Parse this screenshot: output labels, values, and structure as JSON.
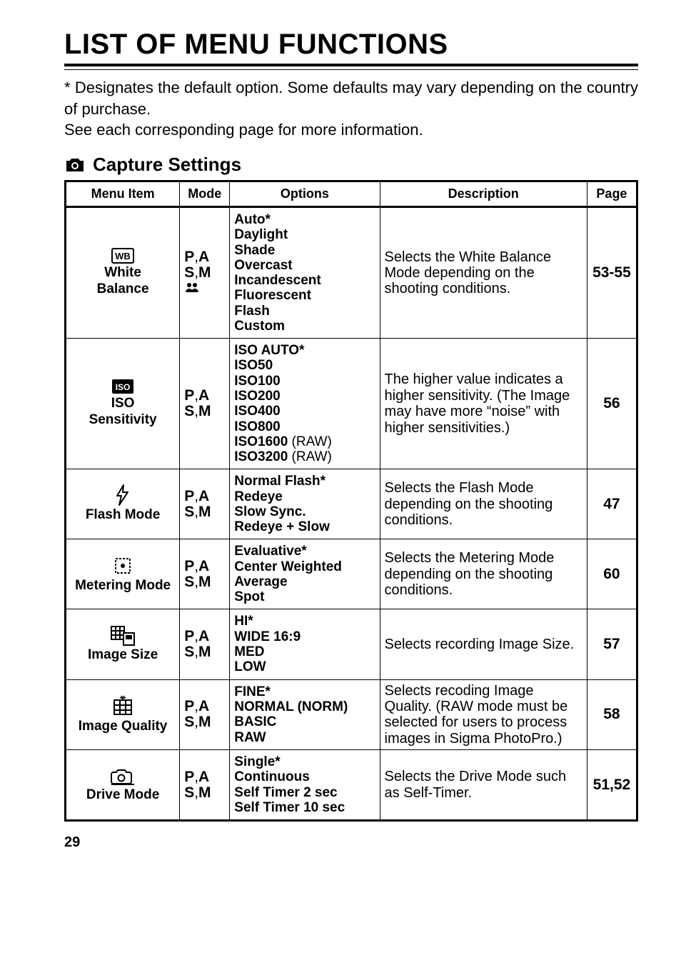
{
  "title": "LIST OF MENU FUNCTIONS",
  "intro": "* Designates the default option.  Some defaults may vary depending on the country of purchase.\nSee each corresponding page for more information.",
  "section_title": "Capture Settings",
  "table": {
    "headers": [
      "Menu Item",
      "Mode",
      "Options",
      "Description",
      "Page"
    ],
    "rows": [
      {
        "icon": "wb-icon",
        "menu_item": "White\nBalance",
        "mode": "P,A\nS,M\n☻",
        "options_bold": "Auto*\nDaylight\nShade\nOvercast\nIncandescent\nFluorescent\nFlash\nCustom",
        "options_trail": "",
        "desc": "Selects the White Balance Mode depending on the shooting conditions.",
        "page": "53-55"
      },
      {
        "icon": "iso-icon",
        "menu_item": "ISO\nSensitivity",
        "mode": "P,A\nS,M",
        "options_html": [
          {
            "b": "ISO AUTO*"
          },
          {
            "b": "ISO50"
          },
          {
            "b": "ISO100"
          },
          {
            "b": "ISO200"
          },
          {
            "b": "ISO400"
          },
          {
            "b": "ISO800"
          },
          {
            "b": "ISO1600",
            "t": " (RAW)"
          },
          {
            "b": "ISO3200",
            "t": " (RAW)"
          }
        ],
        "desc": "The higher value indicates a higher sensitivity. (The Image may have more “noise” with higher sensitivities.)",
        "page": "56"
      },
      {
        "icon": "flash-icon",
        "menu_item": "Flash Mode",
        "mode": "P,A\nS,M",
        "options_bold": "Normal Flash*\nRedeye\nSlow Sync.\nRedeye + Slow",
        "desc": "Selects the Flash Mode depending on the shooting conditions.",
        "page": "47"
      },
      {
        "icon": "metering-icon",
        "menu_item": "Metering Mode",
        "mode": "P,A\nS,M",
        "options_bold": "Evaluative*\nCenter Weighted\nAverage\nSpot",
        "desc": "Selects the Metering Mode depending on the shooting conditions.",
        "page": "60"
      },
      {
        "icon": "imagesize-icon",
        "menu_item": "Image Size",
        "mode": "P,A\nS,M",
        "options_bold": "HI*\nWIDE 16:9\nMED\nLOW",
        "desc": "Selects recording Image Size.",
        "page": "57"
      },
      {
        "icon": "imagequality-icon",
        "menu_item": "Image Quality",
        "mode": "P,A\nS,M",
        "options_bold": "FINE*\nNORMAL (NORM)\nBASIC\nRAW",
        "desc": "Selects recoding Image Quality. (RAW mode must be selected for users to process images in Sigma PhotoPro.)",
        "page": "58"
      },
      {
        "icon": "drive-icon",
        "menu_item": "Drive Mode",
        "mode": "P,A\nS,M",
        "options_bold": "Single*\nContinuous\nSelf Timer 2 sec\nSelf Timer 10 sec",
        "desc": "Selects the Drive Mode such as Self-Timer.",
        "page": "51,52"
      }
    ]
  },
  "page_number": "29"
}
